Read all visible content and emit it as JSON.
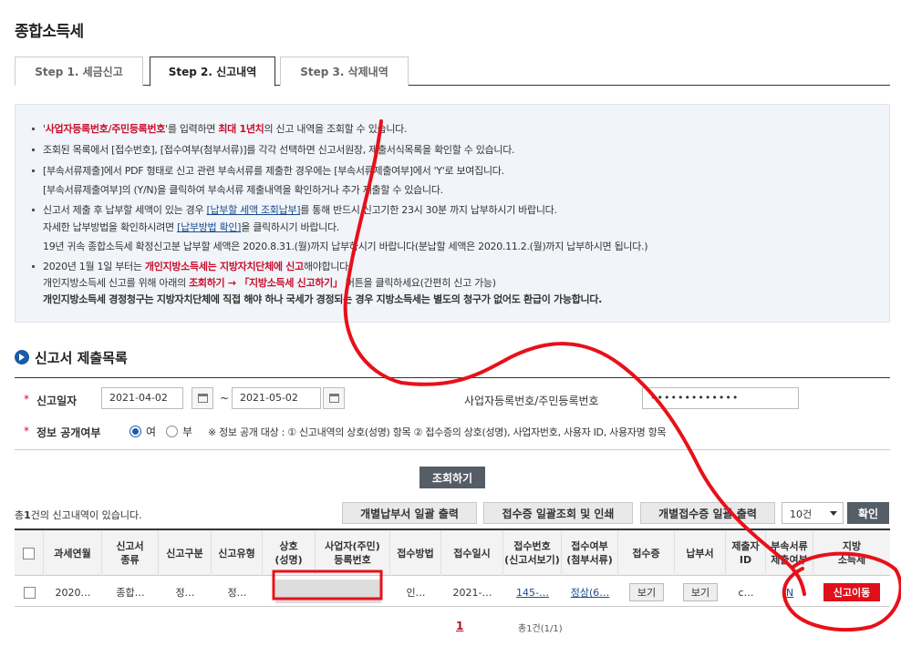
{
  "page_title": "종합소득세",
  "tabs": [
    {
      "label": "Step 1. 세금신고"
    },
    {
      "label": "Step 2. 신고내역"
    },
    {
      "label": "Step 3. 삭제내역"
    }
  ],
  "info": {
    "l1_a": "'",
    "l1_b": "사업자등록번호/주민등록번호",
    "l1_c": "'를 입력하면 ",
    "l1_d": "최대 1년치",
    "l1_e": "의 신고 내역을 조회할 수 있습니다.",
    "l2": "조회된 목록에서 [접수번호], [접수여부(첨부서류)]를 각각 선택하면 신고서원장, 제출서식목록을 확인할 수 있습니다.",
    "l3": "[부속서류제출]에서 PDF 형태로 신고 관련 부속서류를 제출한 경우에는 [부속서류제출여부]에서 'Y'로 보여집니다.",
    "l4": "[부속서류제출여부]의 (Y/N)을 클릭하여 부속서류 제출내역을 확인하거나 추가 제출할 수 있습니다.",
    "l5_a": "신고서 제출 후 납부할 세액이 있는 경우 ",
    "l5_b": "[납부할 세액 조회납부]",
    "l5_c": "를 통해 반드시 신고기한 23시 30분 까지 납부하시기 바랍니다.",
    "l6_a": "자세한 납부방법을 확인하시려면 ",
    "l6_b": "[납부방법 확인]",
    "l6_c": "을 클릭하시기 바랍니다.",
    "l7": "19년 귀속 종합소득세 확정신고분 납부할 세액은 2020.8.31.(월)까지 납부하시기 바랍니다(분납할 세액은 2020.11.2.(월)까지 납부하시면 됩니다.)",
    "l8_a": "2020년 1월 1일 부터는 ",
    "l8_b": "개인지방소득세는 지방자치단체에 신고",
    "l8_c": "해야합니다.",
    "l9_a": "개인지방소득세 신고를 위해 아래의 ",
    "l9_b": "조회하기 → 「지방소득세 신고하기」",
    "l9_c": " 버튼을 클릭하세요(간편히 신고 가능)",
    "l10": "개인지방소득세 경정청구는 지방자치단체에 직접 해야 하나 국세가 경정되는 경우 지방소득세는 별도의 청구가 없어도 환급이 가능합니다."
  },
  "section_title": "신고서 제출목록",
  "search": {
    "date_label": "신고일자",
    "date_from": "2021-04-02",
    "date_to": "2021-05-02",
    "tilde": "~",
    "id_label": "사업자등록번호/주민등록번호",
    "id_value": "•••••••••••••",
    "public_label": "정보 공개여부",
    "radio_yes": "여",
    "radio_no": "부",
    "public_note": "※ 정보 공개 대상 : ① 신고내역의 상호(성명) 항목 ② 접수증의 상호(성명), 사업자번호, 사용자 ID, 사용자명 항목"
  },
  "query_button": "조회하기",
  "result_count_a": "총",
  "result_count_b": "1",
  "result_count_c": "건의 신고내역이 있습니다.",
  "toolbar": {
    "btn1": "개별납부서 일괄 출력",
    "btn2": "접수증 일괄조회 및 인쇄",
    "btn3": "개별접수증 일괄 출력",
    "page_size": "10건",
    "confirm": "확인"
  },
  "table": {
    "headers": [
      "",
      "과세연월",
      "신고서\n종류",
      "신고구분",
      "신고유형",
      "상호\n(성명)",
      "사업자(주민)\n등록번호",
      "접수방법",
      "접수일시",
      "접수번호\n(신고서보기)",
      "접수여부\n(첨부서류)",
      "접수증",
      "납부서",
      "제출자\nID",
      "부속서류\n제출여부",
      "지방\n소득세"
    ],
    "row": {
      "period": "2020…",
      "kind": "종합…",
      "div": "정…",
      "type": "정…",
      "name": "",
      "regno": "",
      "method": "인…",
      "date": "2021-…",
      "rcpt_no": "145-…",
      "status": "정상(6…",
      "receipt_btn": "보기",
      "pay_btn": "보기",
      "submitter": "c…",
      "attach": "N",
      "local_btn": "신고이동"
    }
  },
  "pager": {
    "current": "1",
    "info": "총1건(1/1)"
  },
  "colors": {
    "accent": "#1a5aa8",
    "warning": "#c8102e",
    "annotation": "#e8101a"
  }
}
